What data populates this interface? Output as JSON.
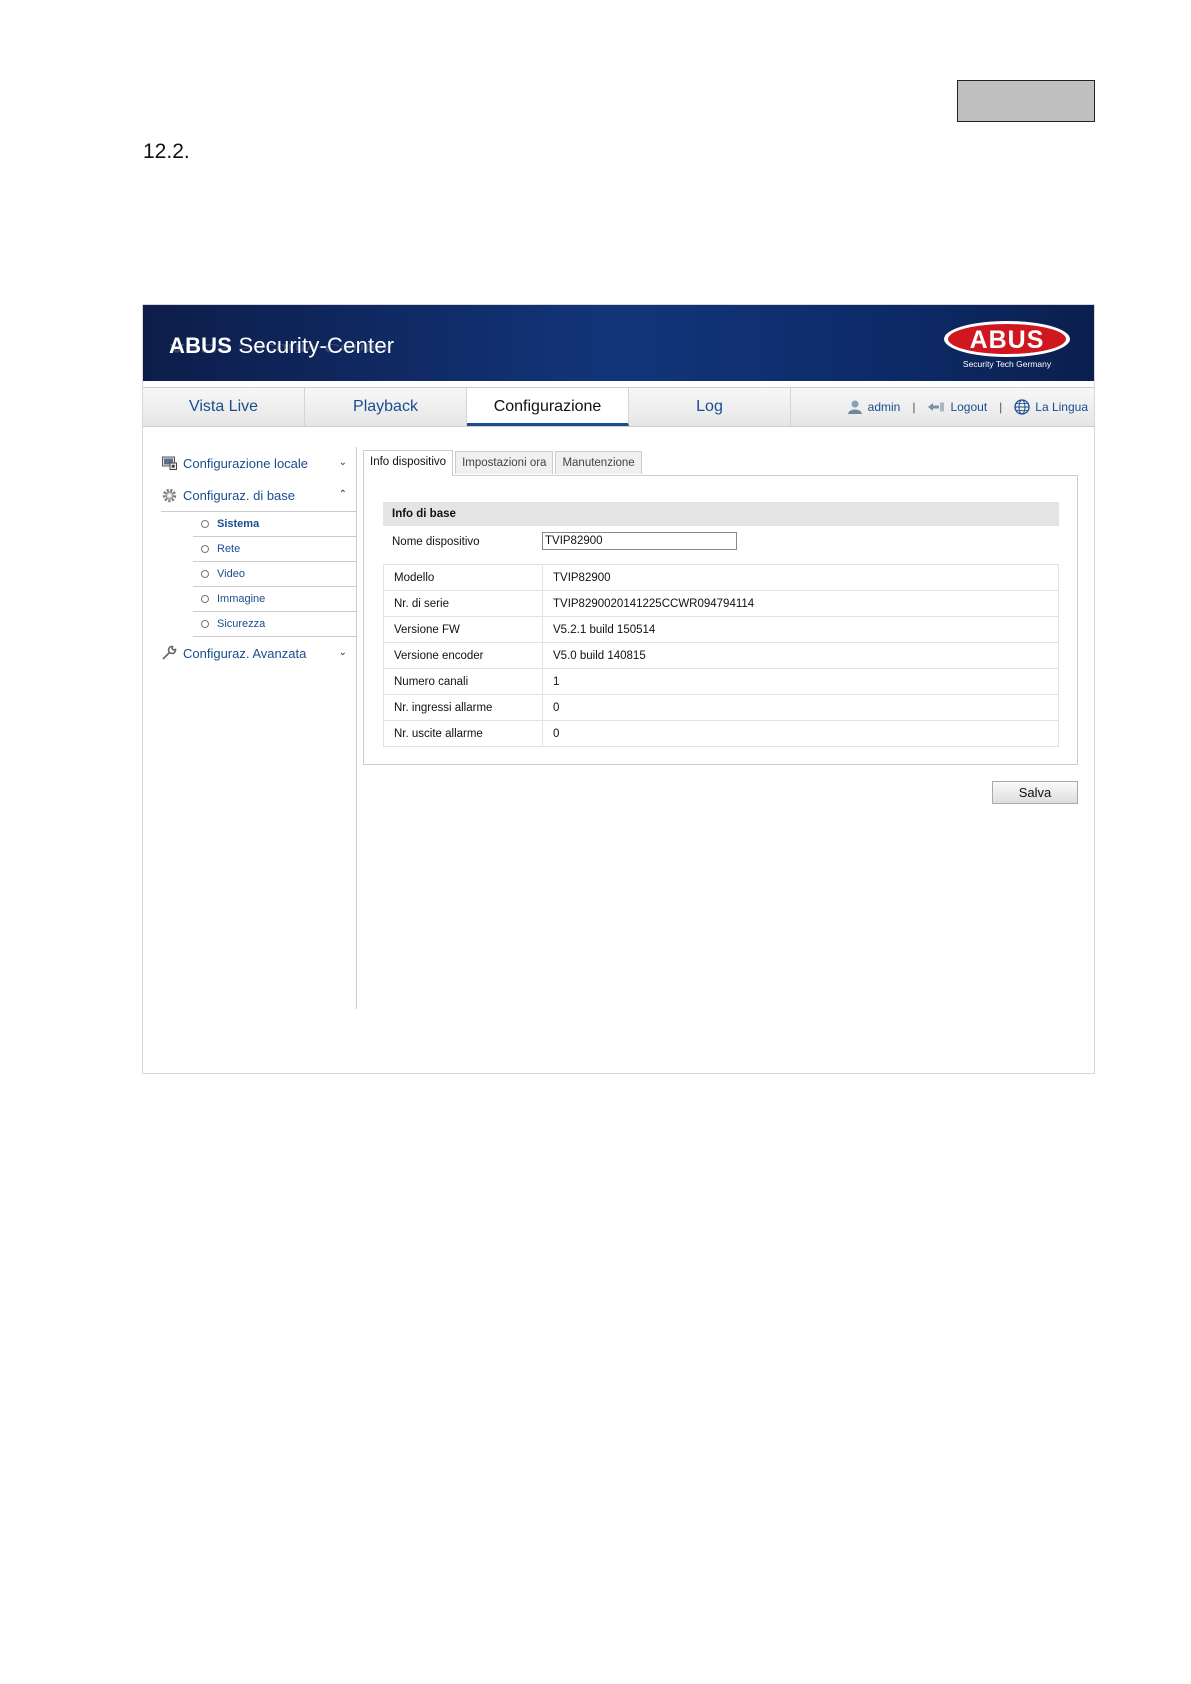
{
  "document": {
    "section_number": "12.2."
  },
  "header": {
    "brand_bold": "ABUS",
    "brand_rest": " Security-Center",
    "logo_text": "ABUS",
    "logo_tagline": "Security Tech Germany"
  },
  "nav": {
    "tabs": [
      {
        "label": "Vista Live"
      },
      {
        "label": "Playback"
      },
      {
        "label": "Configurazione"
      },
      {
        "label": "Log"
      }
    ],
    "active_tab": "Configurazione",
    "user": "admin",
    "logout": "Logout",
    "language": "La Lingua",
    "separator": "|"
  },
  "sidebar": {
    "groups": [
      {
        "label": "Configurazione locale",
        "icon": "monitor-icon",
        "expanded": false
      },
      {
        "label": "Configuraz. di base",
        "icon": "gear-icon",
        "expanded": true
      },
      {
        "label": "Configuraz. Avanzata",
        "icon": "wrench-icon",
        "expanded": false
      }
    ],
    "items": [
      {
        "label": "Sistema",
        "active": true
      },
      {
        "label": "Rete"
      },
      {
        "label": "Video"
      },
      {
        "label": "Immagine"
      },
      {
        "label": "Sicurezza"
      }
    ]
  },
  "subtabs": [
    {
      "label": "Info dispositivo",
      "active": true
    },
    {
      "label": "Impostazioni ora"
    },
    {
      "label": "Manutenzione"
    }
  ],
  "panel": {
    "section_title": "Info di base",
    "device_name_label": "Nome dispositivo",
    "device_name_value": "TVIP82900",
    "rows": [
      {
        "key": "Modello",
        "value": "TVIP82900"
      },
      {
        "key": "Nr. di serie",
        "value": "TVIP8290020141225CCWR094794114"
      },
      {
        "key": "Versione FW",
        "value": "V5.2.1 build 150514"
      },
      {
        "key": "Versione encoder",
        "value": "V5.0 build 140815"
      },
      {
        "key": "Numero canali",
        "value": "1"
      },
      {
        "key": "Nr. ingressi allarme",
        "value": "0"
      },
      {
        "key": "Nr. uscite allarme",
        "value": "0"
      }
    ]
  },
  "actions": {
    "save_label": "Salva"
  },
  "colors": {
    "banner": "#12357a",
    "accent": "#1a4d8f",
    "logo_red": "#d0161f"
  }
}
